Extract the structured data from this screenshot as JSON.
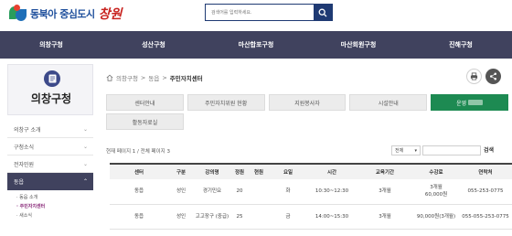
{
  "header": {
    "logo_text": "동북아 중심도시",
    "logo_script": "창원",
    "search_placeholder": "검색어를 입력하세요."
  },
  "gnb": [
    "의창구청",
    "성산구청",
    "마산합포구청",
    "마산회원구청",
    "진해구청"
  ],
  "sidebar": {
    "title": "의창구청",
    "items": [
      {
        "label": "의창구 소개"
      },
      {
        "label": "구청소식"
      },
      {
        "label": "전자민원"
      },
      {
        "label": "동읍"
      }
    ],
    "sub_items": [
      "· 동읍 소개",
      "· 주민자치센터",
      "· 새소식"
    ]
  },
  "breadcrumb": {
    "items": [
      "의창구청",
      "동읍"
    ],
    "current": "주민자치센터"
  },
  "tabs": {
    "row1": [
      "센터안내",
      "주민자치위원 현황",
      "지원봉사자",
      "시설안내",
      "운영"
    ],
    "row2": [
      "활동자료실"
    ]
  },
  "list": {
    "page_info": "현재 페이지 1 / 전체 페이지 3",
    "filter_option": "전체",
    "search_button": "검색"
  },
  "table": {
    "headers": [
      "센터",
      "구분",
      "강의명",
      "정원",
      "현원",
      "요일",
      "시간",
      "교육기간",
      "수강료",
      "연락처"
    ],
    "rows": [
      [
        "동읍",
        "성인",
        "경기민요",
        "20",
        "",
        "화",
        "10:30~12:30",
        "3개월",
        "3개월\n60,000원",
        "055-253-0775"
      ],
      [
        "동읍",
        "성인",
        "고고장구 (중급)",
        "25",
        "",
        "금",
        "14:00~15:30",
        "3개월",
        "90,000원(3개월)",
        "055-055-253-0775"
      ]
    ]
  },
  "colors": {
    "header_nav": "#40425e",
    "active_tab": "#1d8a52",
    "search_border": "#1f3a73"
  }
}
